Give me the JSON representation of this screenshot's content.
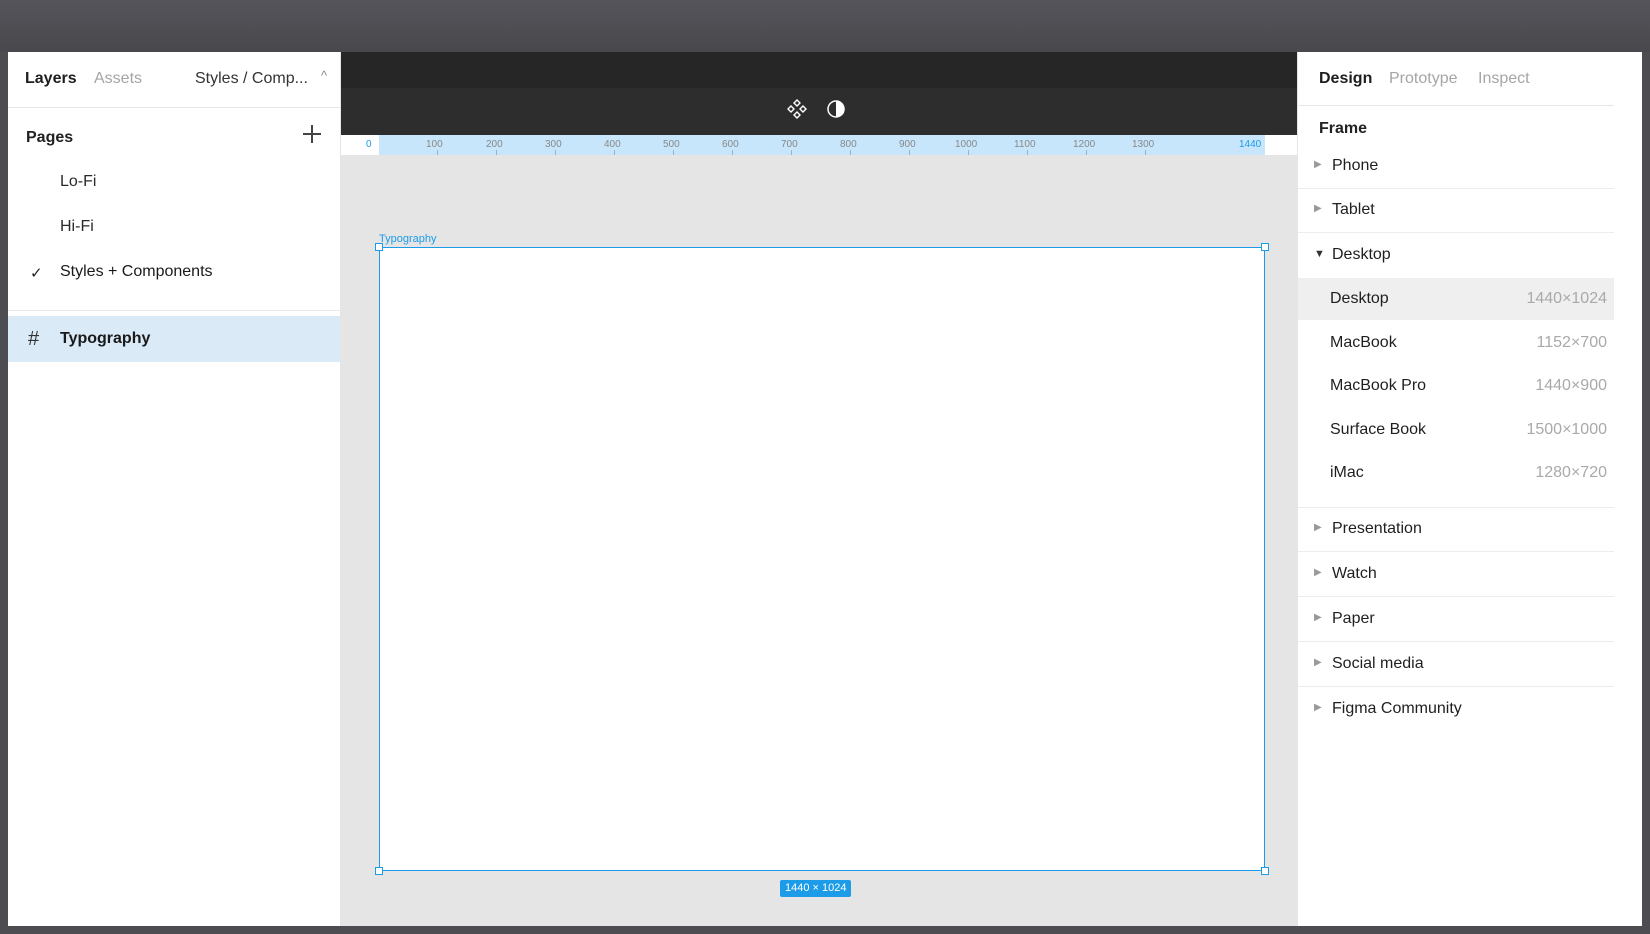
{
  "left_panel": {
    "tabs": [
      "Layers",
      "Assets"
    ],
    "page_select": "Styles / Comp...",
    "pages_heading": "Pages",
    "pages": [
      "Lo-Fi",
      "Hi-Fi",
      "Styles + Components"
    ],
    "current_page_index": 2,
    "layers": [
      {
        "label": "Typography",
        "icon": "frame-hash-icon",
        "selected": true
      }
    ]
  },
  "canvas": {
    "toolbar_icons": [
      "component-icon",
      "contrast-icon"
    ],
    "ruler": {
      "start": "0",
      "labels": [
        "100",
        "200",
        "300",
        "400",
        "500",
        "600",
        "700",
        "800",
        "900",
        "1000",
        "1100",
        "1200",
        "1300"
      ],
      "end": "1440"
    },
    "frame_label": "Typography",
    "frame_size": "1440 × 1024",
    "background": "#e5e5e5",
    "accent": "#1c9be8"
  },
  "right_panel": {
    "tabs": [
      "Design",
      "Prototype",
      "Inspect"
    ],
    "section_heading": "Frame",
    "categories_top": [
      "Phone",
      "Tablet"
    ],
    "expanded_category": "Desktop",
    "presets": [
      {
        "name": "Desktop",
        "size": "1440×1024"
      },
      {
        "name": "MacBook",
        "size": "1152×700"
      },
      {
        "name": "MacBook Pro",
        "size": "1440×900"
      },
      {
        "name": "Surface Book",
        "size": "1500×1000"
      },
      {
        "name": "iMac",
        "size": "1280×720"
      }
    ],
    "selected_preset_index": 0,
    "categories_bottom": [
      "Presentation",
      "Watch",
      "Paper",
      "Social media",
      "Figma Community"
    ]
  }
}
